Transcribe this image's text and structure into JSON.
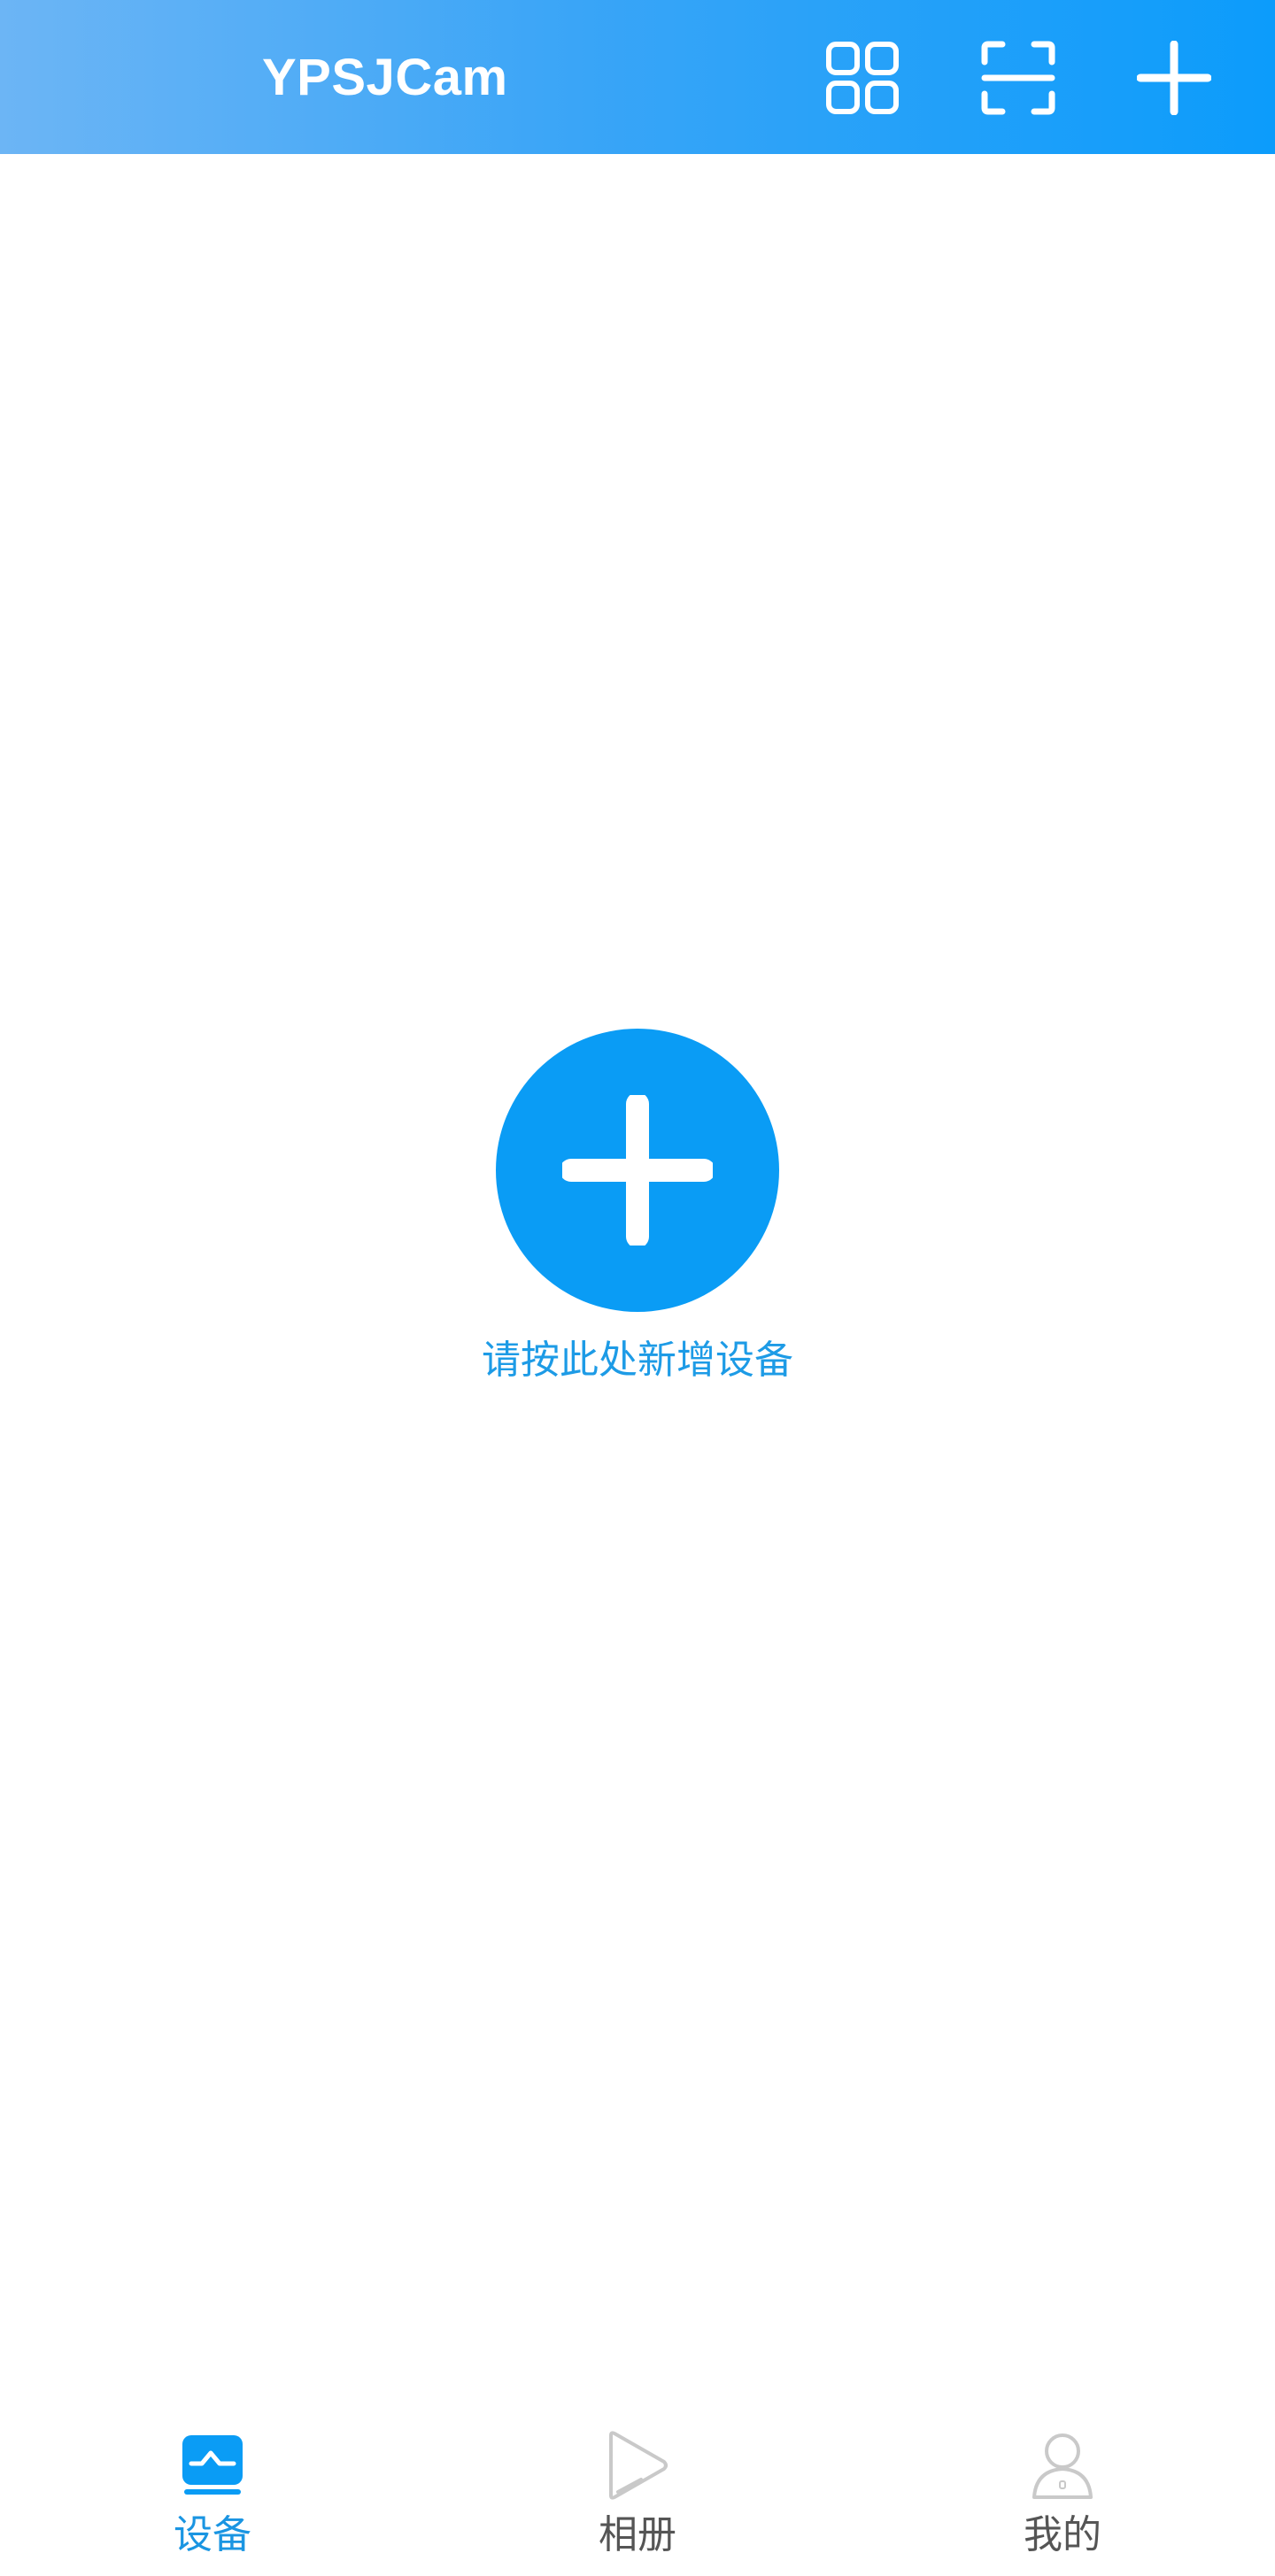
{
  "header": {
    "title": "YPSJCam",
    "icons": {
      "grid": "grid-view-icon",
      "scan": "scan-icon",
      "add": "plus-icon"
    },
    "gradient_start": "#6cb5f5",
    "gradient_end": "#0c9cfb"
  },
  "main": {
    "add_hint": "请按此处新增设备",
    "add_icon": "plus-circle-icon",
    "accent_color": "#0a9cf5"
  },
  "bottom_nav": {
    "items": [
      {
        "label": "设备",
        "icon": "device-monitor-icon",
        "active": true
      },
      {
        "label": "相册",
        "icon": "play-album-icon",
        "active": false
      },
      {
        "label": "我的",
        "icon": "person-icon",
        "active": false
      }
    ],
    "active_color": "#1a95e2",
    "inactive_color": "#555555"
  }
}
